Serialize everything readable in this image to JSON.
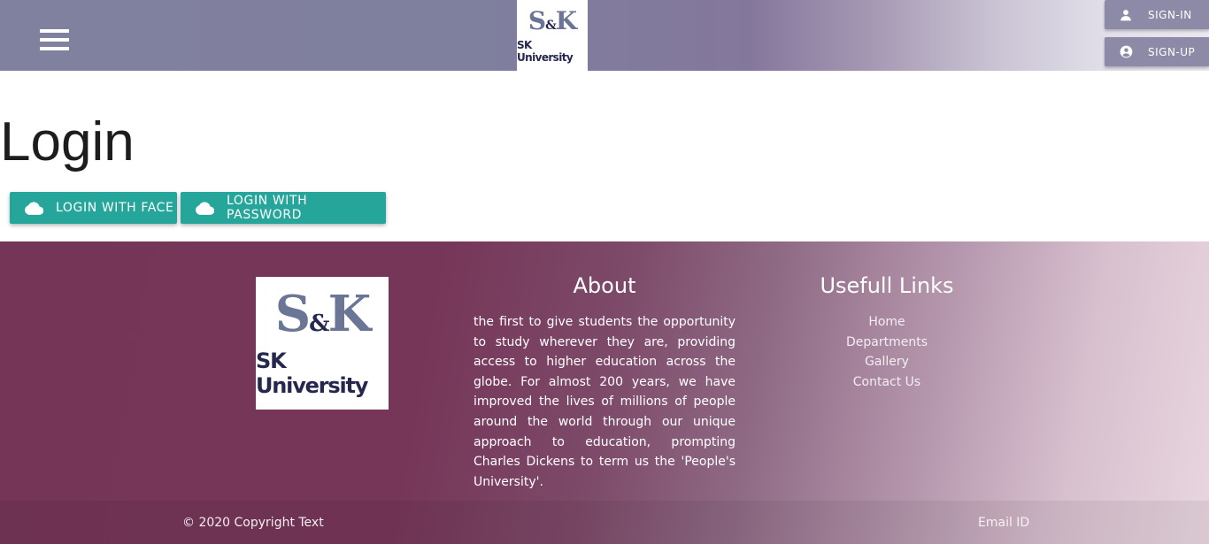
{
  "header": {
    "logo": {
      "mark_left": "S",
      "mark_amp": "&",
      "mark_right": "K",
      "name": "SK University"
    },
    "menu_icon": "hamburger-menu-icon",
    "signin_label": "SIGN-IN",
    "signup_label": "SIGN-UP",
    "signin_icon": "person-icon",
    "signup_icon": "account-circle-icon",
    "colors": {
      "accent": "#8d8aa7"
    }
  },
  "main": {
    "title": "Login",
    "buttons": [
      {
        "label": "LOGIN WITH FACE",
        "icon": "cloud-icon"
      },
      {
        "label": "LOGIN WITH PASSWORD",
        "icon": "cloud-icon"
      }
    ],
    "colors": {
      "button": "#26a69a"
    }
  },
  "footer": {
    "logo": {
      "mark_left": "S",
      "mark_amp": "&",
      "mark_right": "K",
      "name": "SK University"
    },
    "about": {
      "title": "About",
      "text": "the first to give students the opportunity to study wherever they are, providing access to higher education across the globe. For almost 200 years, we have improved the lives of millions of people around the world through our unique approach to education, prompting Charles Dickens to term us the 'People's University'."
    },
    "links": {
      "title": "Usefull Links",
      "items": [
        "Home",
        "Departments",
        "Gallery",
        "Contact Us"
      ]
    },
    "copyright": "© 2020 Copyright Text",
    "email": "Email ID",
    "colors": {
      "background": "#743557"
    }
  }
}
